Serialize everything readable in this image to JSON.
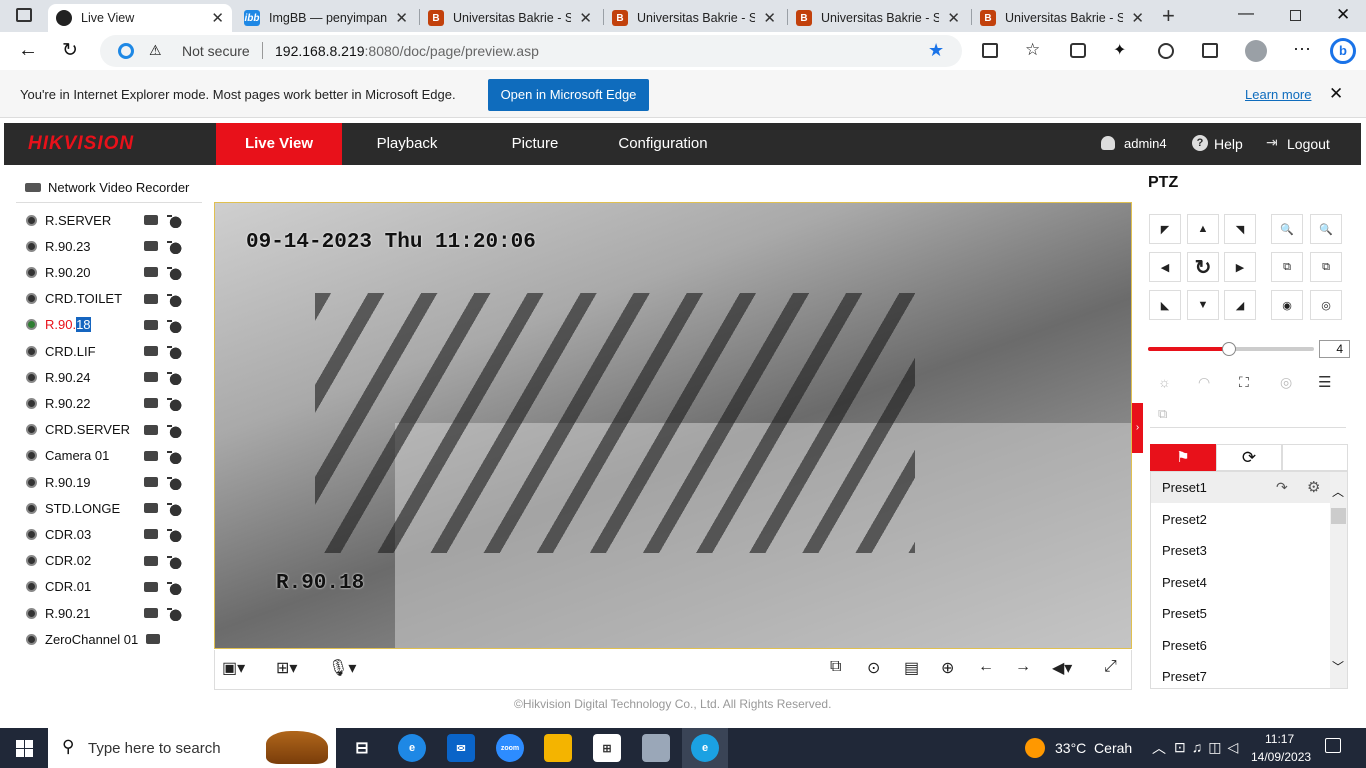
{
  "browser": {
    "tabs": [
      {
        "title": "Live View",
        "active": true,
        "icon": "camera-tab-icon"
      },
      {
        "title": "ImgBB — penyimpanan",
        "icon": "imgbb-icon"
      },
      {
        "title": "Universitas Bakrie - SIM",
        "icon": "bakrie-icon"
      },
      {
        "title": "Universitas Bakrie - SIM",
        "icon": "bakrie-icon"
      },
      {
        "title": "Universitas Bakrie - SIM",
        "icon": "bakrie-icon"
      },
      {
        "title": "Universitas Bakrie - SIM",
        "icon": "bakrie-icon"
      }
    ],
    "not_secure": "Not secure",
    "url_host": "192.168.8.219",
    "url_rest": ":8080/doc/page/preview.asp",
    "ie_message": "You're in Internet Explorer mode. Most pages work better in Microsoft Edge.",
    "ie_button": "Open in Microsoft Edge",
    "learn_more": "Learn more"
  },
  "hik": {
    "logo": "HIKVISION",
    "nav": [
      "Live View",
      "Playback",
      "Picture",
      "Configuration"
    ],
    "user": "admin4",
    "help": "Help",
    "logout": "Logout",
    "tree_title": "Network Video Recorder",
    "cameras": [
      "R.SERVER",
      "R.90.23",
      "R.90.20",
      "CRD.TOILET",
      "R.90.",
      "CRD.LIF",
      "R.90.24",
      "R.90.22",
      "CRD.SERVER",
      "Camera 01",
      "R.90.19",
      "STD.LONGE",
      "CDR.03",
      "CDR.02",
      "CDR.01",
      "R.90.21",
      "ZeroChannel 01"
    ],
    "selected_suffix": "18",
    "osd_time": "09-14-2023 Thu 11:20:06",
    "osd_name": "R.90.18",
    "ptz_title": "PTZ",
    "speed": "4",
    "speed_fraction": 0.49,
    "presets": [
      "Preset1",
      "Preset2",
      "Preset3",
      "Preset4",
      "Preset5",
      "Preset6",
      "Preset7"
    ],
    "footer": "©Hikvision Digital Technology Co., Ltd. All Rights Reserved."
  },
  "taskbar": {
    "search": "Type here to search",
    "weather": "33°C  Cerah",
    "time": "11:17",
    "date": "14/09/2023"
  }
}
